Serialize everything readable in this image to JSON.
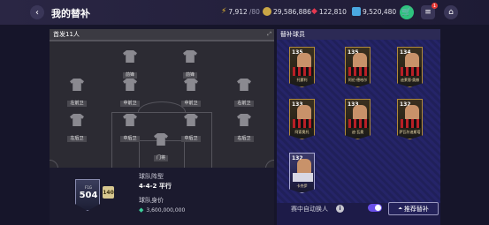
{
  "header": {
    "title": "我的替补",
    "resources": [
      {
        "icon": "lightning-icon",
        "value": "7,912",
        "sub": "/80"
      },
      {
        "icon": "coin-icon",
        "value": "29,586,886",
        "sub": ""
      },
      {
        "icon": "ruby-icon",
        "value": "122,810",
        "sub": ""
      },
      {
        "icon": "gem-icon",
        "value": "9,520,480",
        "sub": ""
      }
    ],
    "notification_count": "1"
  },
  "starting_panel": {
    "title": "首发11人",
    "players": [
      {
        "pos": "前锋"
      },
      {
        "pos": "前锋"
      },
      {
        "pos": "左前卫"
      },
      {
        "pos": "中前卫"
      },
      {
        "pos": "中前卫"
      },
      {
        "pos": "右前卫"
      },
      {
        "pos": "左后卫"
      },
      {
        "pos": "中后卫"
      },
      {
        "pos": "中后卫"
      },
      {
        "pos": "右后卫"
      },
      {
        "pos": "门将"
      }
    ]
  },
  "team_info": {
    "badge_label": "F1G",
    "team_ovr": "504",
    "chem": "140",
    "formation_label": "球队阵型",
    "formation": "4-4-2 平行",
    "value_label": "球队身价",
    "value": "3,600,000,000"
  },
  "subs_panel": {
    "title": "替补球员",
    "cards": [
      {
        "rating": "135",
        "name": "托蒙利",
        "style": "red"
      },
      {
        "rating": "135",
        "name": "阿伦·德哈尔",
        "style": "red"
      },
      {
        "rating": "134",
        "name": "迪莱恩·奥赫",
        "style": "red"
      },
      {
        "rating": "133",
        "name": "阿索奥托",
        "style": "red"
      },
      {
        "rating": "133",
        "name": "迪-瓦奥",
        "style": "red"
      },
      {
        "rating": "132",
        "name": "萨瓦尔迪斯塔",
        "style": "red"
      },
      {
        "rating": "132",
        "name": "卡杰伊",
        "style": "blue"
      }
    ]
  },
  "auto_sub": {
    "label": "赛中自动换人",
    "enabled": true,
    "recommend_label": "推荐替补"
  },
  "colors": {
    "accent": "#6a50e8",
    "shop_green": "#2ec27e"
  }
}
